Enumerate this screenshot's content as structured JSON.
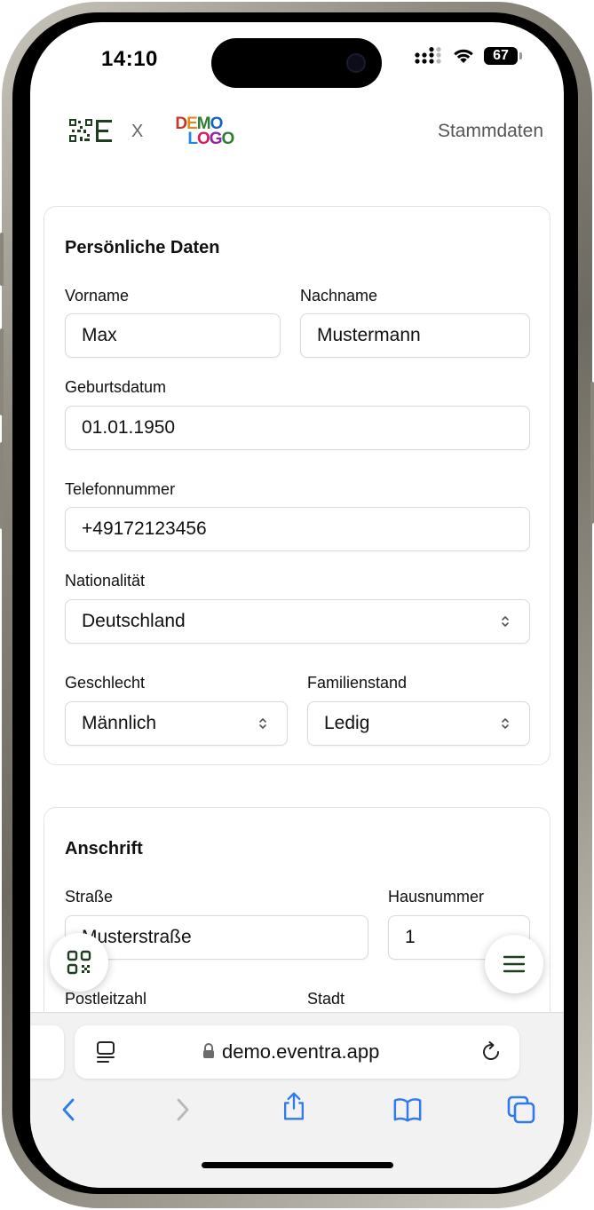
{
  "status_bar": {
    "time": "14:10",
    "battery": "67"
  },
  "header": {
    "times_symbol": "X",
    "demo_logo_line1": [
      "D",
      "E",
      "M",
      "O"
    ],
    "demo_logo_line2": [
      "L",
      "O",
      "G",
      "O"
    ],
    "title": "Stammdaten"
  },
  "personal": {
    "title": "Persönliche Daten",
    "firstname_label": "Vorname",
    "firstname_value": "Max",
    "lastname_label": "Nachname",
    "lastname_value": "Mustermann",
    "birthdate_label": "Geburtsdatum",
    "birthdate_value": "01.01.1950",
    "phone_label": "Telefonnummer",
    "phone_value": "+49172123456",
    "nationality_label": "Nationalität",
    "nationality_value": "Deutschland",
    "gender_label": "Geschlecht",
    "gender_value": "Männlich",
    "marital_label": "Familienstand",
    "marital_value": "Ledig"
  },
  "address": {
    "title": "Anschrift",
    "street_label": "Straße",
    "street_value": "Musterstraße",
    "housenumber_label": "Hausnummer",
    "housenumber_value": "1",
    "zip_label": "Postleitzahl",
    "city_label": "Stadt"
  },
  "browser": {
    "url": "demo.eventra.app"
  },
  "icons": {
    "qr_fab": "qr-scan-icon",
    "menu_fab": "hamburger-menu-icon",
    "reader": "reader-mode-icon",
    "lock": "lock-icon",
    "reload": "reload-icon",
    "back": "chevron-left-icon",
    "forward": "chevron-right-icon",
    "share": "share-icon",
    "bookmarks": "book-icon",
    "tabs": "tabs-icon"
  },
  "colors": {
    "accent_green": "#1f3d1f",
    "safari_blue": "#2f7bea"
  }
}
